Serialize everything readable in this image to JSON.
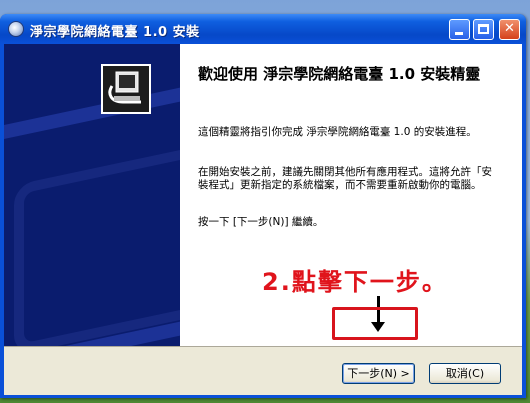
{
  "window": {
    "title": "淨宗學院網絡電臺 1.0 安裝"
  },
  "content": {
    "heading": "歡迎使用 淨宗學院網絡電臺 1.0 安裝精靈",
    "para1": "這個精靈將指引你完成 淨宗學院網絡電臺 1.0 的安裝進程。",
    "para2": "在開始安裝之前，建議先關閉其他所有應用程式。這將允許「安裝程式」更新指定的系統檔案，而不需要重新啟動你的電腦。",
    "para3": "按一下 [下一步(N)] 繼續。"
  },
  "buttons": {
    "next": "下一步(N) >",
    "cancel": "取消(C)"
  },
  "annotation": {
    "text": "2.點擊下一步。"
  },
  "colors": {
    "title_bar": "#0a50d8",
    "side_panel": "#0a1c6e",
    "annotation": "#e0141c"
  }
}
